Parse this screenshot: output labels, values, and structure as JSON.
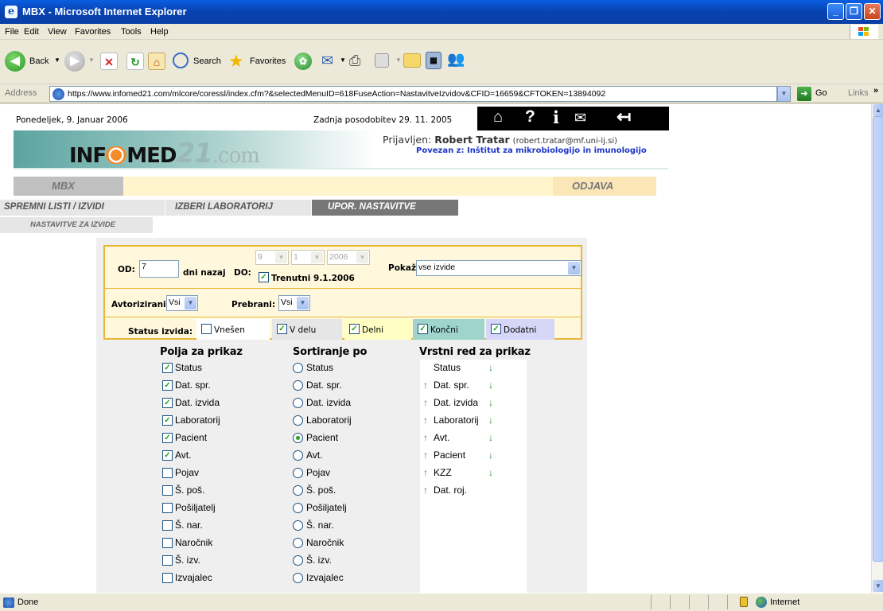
{
  "window": {
    "title": "MBX - Microsoft Internet Explorer"
  },
  "menu": [
    "File",
    "Edit",
    "View",
    "Favorites",
    "Tools",
    "Help"
  ],
  "toolbar": {
    "back": "Back",
    "search": "Search",
    "favorites": "Favorites"
  },
  "address": {
    "label": "Address",
    "url": "https://www.infomed21.com/mlcore/coressl/index.cfm?&selectedMenuID=618FuseAction=NastavitveIzvidov&CFID=16659&CFTOKEN=13894092",
    "go": "Go",
    "links": "Links"
  },
  "header": {
    "date": "Ponedeljek, 9. Januar 2006",
    "last_update": "Zadnja posodobitev 29. 11. 2005",
    "logo_info": "INF",
    "logo_med": "MED",
    "logo_21": "21",
    "logo_com": ".com",
    "login_label": "Prijavljen:",
    "user_name": "Robert Tratar",
    "user_email": "(robert.tratar@mf.uni-lj.si)",
    "connected": "Povezan z: Inštitut za mikrobiologijo in imunologijo",
    "icons": [
      "home-icon",
      "help-icon",
      "info-icon",
      "mail-icon",
      "exit-icon"
    ]
  },
  "nav": {
    "app": "MBX",
    "logout": "ODJAVA",
    "tabs": [
      "SPREMNI LISTI / IZVIDI",
      "IZBERI LABORATORIJ",
      "UPOR. NASTAVITVE"
    ],
    "subtab": "NASTAVITVE ZA IZVIDE"
  },
  "filters": {
    "od_label": "OD:",
    "od_value": "7",
    "days_label": "dni nazaj",
    "do_label": "DO:",
    "do_day": "9",
    "do_month": "1",
    "do_year": "2006",
    "current_label": "Trenutni 9.1.2006",
    "pokazi_label": "Pokaži:",
    "pokazi_value": "vse izvide",
    "avtorizirani_label": "Avtorizirani:",
    "avtorizirani_value": "Vsi",
    "prebrani_label": "Prebrani:",
    "prebrani_value": "Vsi",
    "status_label": "Status izvida:",
    "statuses": [
      {
        "label": "Vnešen",
        "checked": false,
        "color": "#ffffff"
      },
      {
        "label": "V delu",
        "checked": true,
        "color": "#e6e6e6"
      },
      {
        "label": "Delni",
        "checked": true,
        "color": "#ffffc4"
      },
      {
        "label": "Končni",
        "checked": true,
        "color": "#9ed4cc"
      },
      {
        "label": "Dodatni",
        "checked": true,
        "color": "#d6d6f8"
      }
    ]
  },
  "columns": {
    "fields_head": "Polja za prikaz",
    "sort_head": "Sortiranje po",
    "order_head": "Vrstni red za prikaz",
    "fields": [
      {
        "label": "Status",
        "checked": true
      },
      {
        "label": "Dat. spr.",
        "checked": true
      },
      {
        "label": "Dat. izvida",
        "checked": true
      },
      {
        "label": "Laboratorij",
        "checked": true
      },
      {
        "label": "Pacient",
        "checked": true
      },
      {
        "label": "Avt.",
        "checked": true
      },
      {
        "label": "Pojav",
        "checked": false
      },
      {
        "label": "Š. poš.",
        "checked": false
      },
      {
        "label": "Pošiljatelj",
        "checked": false
      },
      {
        "label": "Š. nar.",
        "checked": false
      },
      {
        "label": "Naročnik",
        "checked": false
      },
      {
        "label": "Š. izv.",
        "checked": false
      },
      {
        "label": "Izvajalec",
        "checked": false
      }
    ],
    "sort": [
      {
        "label": "Status",
        "selected": false
      },
      {
        "label": "Dat. spr.",
        "selected": false
      },
      {
        "label": "Dat. izvida",
        "selected": false
      },
      {
        "label": "Laboratorij",
        "selected": false
      },
      {
        "label": "Pacient",
        "selected": true
      },
      {
        "label": "Avt.",
        "selected": false
      },
      {
        "label": "Pojav",
        "selected": false
      },
      {
        "label": "Š. poš.",
        "selected": false
      },
      {
        "label": "Pošiljatelj",
        "selected": false
      },
      {
        "label": "Š. nar.",
        "selected": false
      },
      {
        "label": "Naročnik",
        "selected": false
      },
      {
        "label": "Š. izv.",
        "selected": false
      },
      {
        "label": "Izvajalec",
        "selected": false
      }
    ],
    "order": [
      {
        "label": "Status",
        "up": false,
        "down": true
      },
      {
        "label": "Dat. spr.",
        "up": true,
        "down": true
      },
      {
        "label": "Dat. izvida",
        "up": true,
        "down": true
      },
      {
        "label": "Laboratorij",
        "up": true,
        "down": true
      },
      {
        "label": "Avt.",
        "up": true,
        "down": true
      },
      {
        "label": "Pacient",
        "up": true,
        "down": true
      },
      {
        "label": "KZZ",
        "up": true,
        "down": true
      },
      {
        "label": "Dat. roj.",
        "up": true,
        "down": false
      }
    ]
  },
  "status": {
    "text": "Done",
    "zone": "Internet"
  }
}
